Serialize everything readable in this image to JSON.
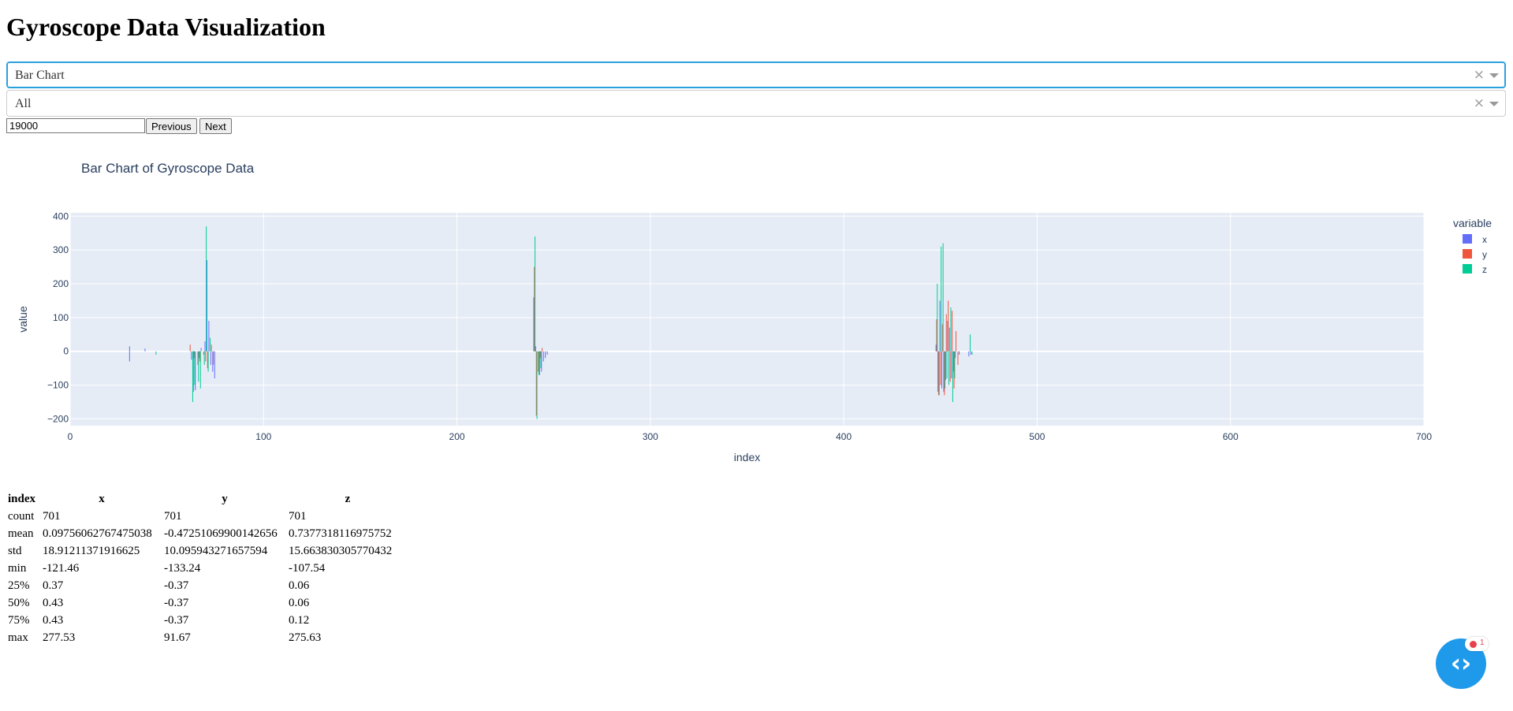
{
  "page": {
    "title": "Gyroscope Data Visualization"
  },
  "controls": {
    "chart_type": {
      "value": "Bar Chart",
      "clear": "×"
    },
    "axis_filter": {
      "value": "All",
      "clear": "×"
    },
    "offset_input": {
      "value": "19000"
    },
    "previous_label": "Previous",
    "next_label": "Next"
  },
  "chart_data": {
    "type": "bar",
    "title": "Bar Chart of Gyroscope Data",
    "xlabel": "index",
    "ylabel": "value",
    "xlim": [
      0,
      700
    ],
    "ylim": [
      -220,
      410
    ],
    "xticks": [
      0,
      100,
      200,
      300,
      400,
      500,
      600,
      700
    ],
    "yticks": [
      -200,
      -100,
      0,
      100,
      200,
      300,
      400
    ],
    "legend_title": "variable",
    "legend_position": "right",
    "grid": true,
    "series": [
      {
        "name": "x",
        "color": "#636efa",
        "points": [
          [
            31,
            -30
          ],
          [
            31,
            15
          ],
          [
            39,
            8
          ],
          [
            63,
            -25
          ],
          [
            64,
            -120
          ],
          [
            65,
            -115
          ],
          [
            67,
            -20
          ],
          [
            68,
            10
          ],
          [
            70,
            30
          ],
          [
            71,
            270
          ],
          [
            72,
            90
          ],
          [
            73,
            -40
          ],
          [
            74,
            -60
          ],
          [
            75,
            -80
          ],
          [
            240,
            160
          ],
          [
            241,
            15
          ],
          [
            243,
            -70
          ],
          [
            244,
            -60
          ],
          [
            245,
            -30
          ],
          [
            246,
            -20
          ],
          [
            247,
            -10
          ],
          [
            448,
            20
          ],
          [
            449,
            -120
          ],
          [
            450,
            150
          ],
          [
            451,
            -110
          ],
          [
            452,
            -120
          ],
          [
            453,
            -85
          ],
          [
            454,
            90
          ],
          [
            455,
            70
          ],
          [
            456,
            -80
          ],
          [
            457,
            -60
          ],
          [
            458,
            -20
          ],
          [
            460,
            -10
          ],
          [
            465,
            -15
          ],
          [
            466,
            -10
          ]
        ]
      },
      {
        "name": "y",
        "color": "#ef553b",
        "points": [
          [
            62,
            20
          ],
          [
            64,
            -20
          ],
          [
            66,
            -40
          ],
          [
            67,
            -30
          ],
          [
            69,
            -10
          ],
          [
            70,
            -30
          ],
          [
            71,
            -50
          ],
          [
            73,
            20
          ],
          [
            74,
            -40
          ],
          [
            240,
            250
          ],
          [
            241,
            -190
          ],
          [
            242,
            -60
          ],
          [
            243,
            -20
          ],
          [
            244,
            10
          ],
          [
            448,
            95
          ],
          [
            449,
            -130
          ],
          [
            450,
            -100
          ],
          [
            451,
            80
          ],
          [
            452,
            -130
          ],
          [
            453,
            110
          ],
          [
            454,
            150
          ],
          [
            455,
            -90
          ],
          [
            456,
            120
          ],
          [
            457,
            -110
          ],
          [
            458,
            60
          ],
          [
            459,
            -40
          ]
        ]
      },
      {
        "name": "z",
        "color": "#00cc96",
        "points": [
          [
            44,
            -10
          ],
          [
            63,
            -150
          ],
          [
            64,
            -100
          ],
          [
            66,
            -90
          ],
          [
            67,
            -110
          ],
          [
            69,
            -40
          ],
          [
            70,
            370
          ],
          [
            71,
            -60
          ],
          [
            72,
            40
          ],
          [
            240,
            340
          ],
          [
            241,
            -200
          ],
          [
            242,
            -70
          ],
          [
            243,
            -50
          ],
          [
            448,
            200
          ],
          [
            449,
            -130
          ],
          [
            450,
            310
          ],
          [
            451,
            320
          ],
          [
            452,
            -110
          ],
          [
            453,
            -80
          ],
          [
            454,
            -100
          ],
          [
            455,
            130
          ],
          [
            456,
            -150
          ],
          [
            457,
            -80
          ],
          [
            465,
            50
          ],
          [
            466,
            -10
          ]
        ]
      }
    ]
  },
  "stats_table": {
    "headers": [
      "index",
      "x",
      "y",
      "z"
    ],
    "rows": [
      [
        "count",
        "701",
        "701",
        "701"
      ],
      [
        "mean",
        "0.09756062767475038",
        "-0.47251069900142656",
        "0.7377318116975752"
      ],
      [
        "std",
        "18.91211371916625",
        "10.095943271657594",
        "15.663830305770432"
      ],
      [
        "min",
        "-121.46",
        "-133.24",
        "-107.54"
      ],
      [
        "25%",
        "0.37",
        "-0.37",
        "0.06"
      ],
      [
        "50%",
        "0.43",
        "-0.37",
        "0.06"
      ],
      [
        "75%",
        "0.43",
        "-0.37",
        "0.12"
      ],
      [
        "max",
        "277.53",
        "91.67",
        "275.63"
      ]
    ]
  },
  "fab": {
    "icon": "code-brackets-icon",
    "badge_count": "1"
  }
}
